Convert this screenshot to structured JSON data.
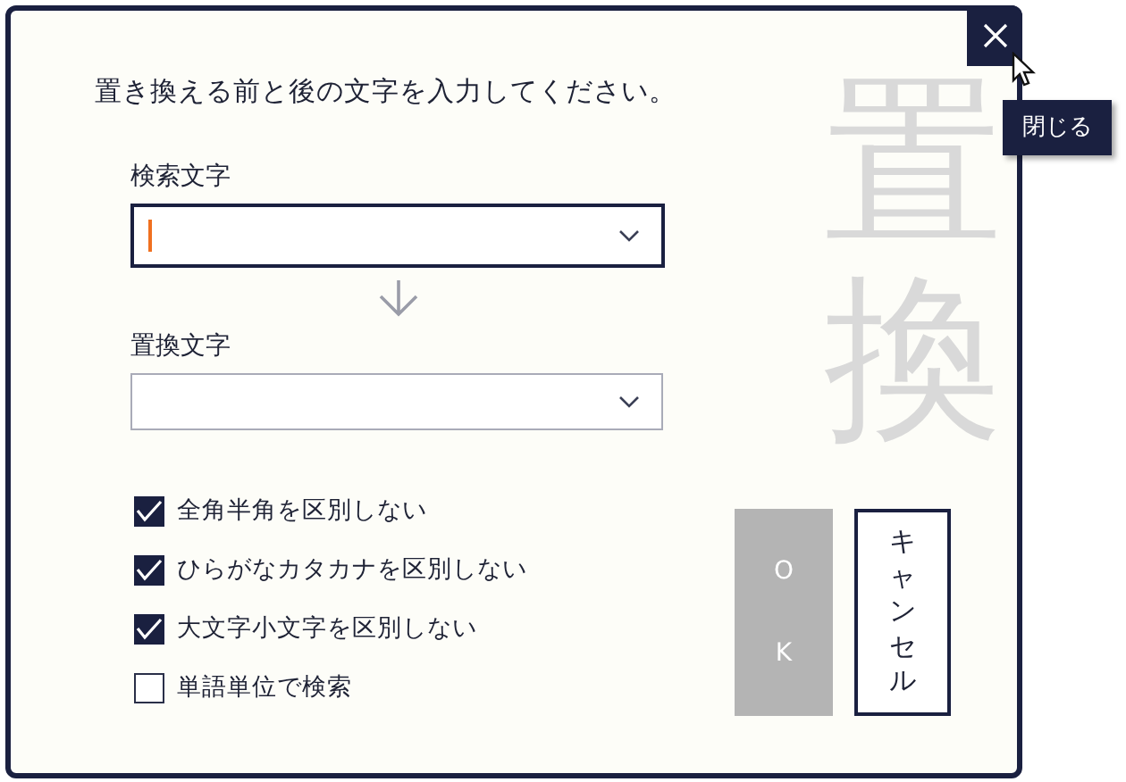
{
  "dialog": {
    "watermark": "置換",
    "close_tooltip": "閉じる",
    "instruction": "置き換える前と後の文字を入力してください。",
    "fields": [
      {
        "label": "検索文字",
        "focused": true
      },
      {
        "label": "置換文字",
        "focused": false
      }
    ],
    "options": [
      {
        "label": "全角半角を区別しない",
        "checked": true
      },
      {
        "label": "ひらがなカタカナを区別しない",
        "checked": true
      },
      {
        "label": "大文字小文字を区別しない",
        "checked": true
      },
      {
        "label": "単語単位で検索",
        "checked": false
      }
    ],
    "buttons": [
      {
        "label": "OK",
        "disabled": true
      },
      {
        "label": "キャンセル",
        "disabled": false
      }
    ]
  }
}
